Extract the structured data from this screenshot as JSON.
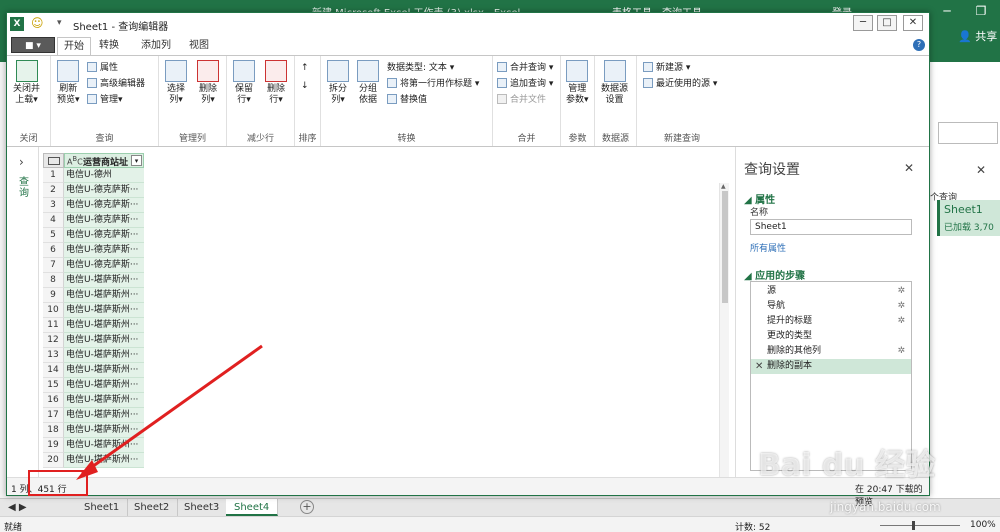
{
  "excel": {
    "title": "新建 Microsoft Excel 工作表 (3).xlsx - Excel",
    "ctx_tab_1": "表格工具",
    "ctx_tab_2": "查询工具",
    "login": "登录",
    "share": "共享",
    "right_pane_query_label": "个查询",
    "right_pane_card_name": "Sheet1",
    "right_pane_card_status": "已加载 3,70",
    "sheet_tabs": [
      "Sheet1",
      "Sheet2",
      "Sheet3",
      "Sheet4"
    ],
    "active_sheet": "Sheet4",
    "status_ready": "就绪",
    "status_count": "计数: 52",
    "zoom": "100%"
  },
  "qe": {
    "title": "Sheet1 - 查询编辑器",
    "file_label": "■ ▾",
    "tabs": [
      "开始",
      "转换",
      "添加列",
      "视图"
    ],
    "ribbon": {
      "close_load": "关闭并\n上载▾",
      "refresh_preview": "刷新\n预览▾",
      "properties": "属性",
      "advanced_editor": "高级编辑器",
      "manage": "管理▾",
      "choose_columns": "选择\n列▾",
      "remove_columns": "删除\n列▾",
      "keep_rows": "保留\n行▾",
      "remove_rows": "删除\n行▾",
      "split_column": "拆分\n列▾",
      "group_by": "分组\n依据",
      "data_type": "数据类型: 文本 ▾",
      "first_row_header": "将第一行用作标题 ▾",
      "replace_values": "替换值",
      "merge_queries": "合并查询 ▾",
      "append_queries": "追加查询 ▾",
      "combine_files": "合并文件",
      "manage_params": "管理\n参数▾",
      "data_source_settings": "数据源\n设置",
      "new_source": "新建源 ▾",
      "recent_sources": "最近使用的源 ▾",
      "groups": [
        "关闭",
        "查询",
        "管理列",
        "减少行",
        "排序",
        "转换",
        "合并",
        "参数",
        "数据源",
        "新建查询"
      ]
    },
    "nav_label": "查询",
    "table": {
      "column": "运营商站址",
      "row_numbers": [
        "1",
        "2",
        "3",
        "4",
        "5",
        "6",
        "7",
        "8",
        "9",
        "10",
        "11",
        "12",
        "13",
        "14",
        "15",
        "16",
        "17",
        "18",
        "19",
        "20"
      ],
      "rows": [
        "电信U-德州",
        "电信U-德克萨斯···",
        "电信U-德克萨斯···",
        "电信U-德克萨斯···",
        "电信U-德克萨斯···",
        "电信U-德克萨斯···",
        "电信U-德克萨斯···",
        "电信U-堪萨斯州···",
        "电信U-堪萨斯州···",
        "电信U-堪萨斯州···",
        "电信U-堪萨斯州···",
        "电信U-堪萨斯州···",
        "电信U-堪萨斯州···",
        "电信U-堪萨斯州···",
        "电信U-堪萨斯州···",
        "电信U-堪萨斯州···",
        "电信U-堪萨斯州···",
        "电信U-堪萨斯州···",
        "电信U-堪萨斯州···",
        "电信U-堪萨斯州···"
      ]
    },
    "settings": {
      "header": "查询设置",
      "properties_section": "属性",
      "name_label": "名称",
      "name_value": "Sheet1",
      "all_properties": "所有属性",
      "steps_section": "应用的步骤",
      "steps": [
        "源",
        "导航",
        "提升的标题",
        "更改的类型",
        "删除的其他列",
        "删除的副本"
      ],
      "selected_step": 5
    },
    "status_left": "1 列、451 行",
    "status_right": "在 20:47 下载的预览"
  },
  "watermark": "Bai du 经验",
  "watermark_url": "jingyan.baidu.com"
}
